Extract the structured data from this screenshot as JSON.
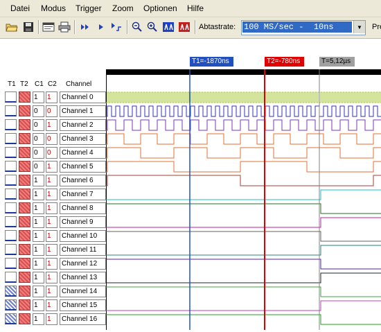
{
  "menu": [
    "Datei",
    "Modus",
    "Trigger",
    "Zoom",
    "Optionen",
    "Hilfe"
  ],
  "toolbar": {
    "buttons": [
      "open-icon",
      "save-icon",
      "window-icon",
      "print-icon",
      "fast-forward-icon",
      "play-icon",
      "trigger-step-icon",
      "zoom-out-icon",
      "zoom-in-icon",
      "marker-t1-icon",
      "marker-t2-icon"
    ],
    "rate_label": "Abtastrate:",
    "rate_value": "100 MS/sec -  10ns",
    "pre_label": "Pre"
  },
  "table_headers": {
    "t1": "T1",
    "t2": "T2",
    "c1": "C1",
    "c2": "C2",
    "channel": "Channel"
  },
  "channels": [
    {
      "name": "Channel 0",
      "c1": "1",
      "c2": "1",
      "t1_hatch": false
    },
    {
      "name": "Channel 1",
      "c1": "0",
      "c2": "0",
      "t1_hatch": false
    },
    {
      "name": "Channel 2",
      "c1": "0",
      "c2": "1",
      "t1_hatch": false
    },
    {
      "name": "Channel 3",
      "c1": "0",
      "c2": "0",
      "t1_hatch": false
    },
    {
      "name": "Channel 4",
      "c1": "0",
      "c2": "0",
      "t1_hatch": false
    },
    {
      "name": "Channel 5",
      "c1": "0",
      "c2": "1",
      "t1_hatch": false
    },
    {
      "name": "Channel 6",
      "c1": "1",
      "c2": "1",
      "t1_hatch": false
    },
    {
      "name": "Channel 7",
      "c1": "1",
      "c2": "1",
      "t1_hatch": false
    },
    {
      "name": "Channel 8",
      "c1": "1",
      "c2": "1",
      "t1_hatch": false
    },
    {
      "name": "Channel 9",
      "c1": "1",
      "c2": "1",
      "t1_hatch": false
    },
    {
      "name": "Channel 10",
      "c1": "1",
      "c2": "1",
      "t1_hatch": false
    },
    {
      "name": "Channel 11",
      "c1": "1",
      "c2": "1",
      "t1_hatch": false
    },
    {
      "name": "Channel 12",
      "c1": "1",
      "c2": "1",
      "t1_hatch": false
    },
    {
      "name": "Channel 13",
      "c1": "1",
      "c2": "1",
      "t1_hatch": false
    },
    {
      "name": "Channel 14",
      "c1": "1",
      "c2": "1",
      "t1_hatch": true
    },
    {
      "name": "Channel 15",
      "c1": "1",
      "c2": "1",
      "t1_hatch": true
    },
    {
      "name": "Channel 16",
      "c1": "1",
      "c2": "1",
      "t1_hatch": true
    }
  ],
  "markers": {
    "t1": {
      "label": "T1=-1870ns",
      "color": "#2050c0"
    },
    "t2": {
      "label": "T2=-780ns",
      "color": "#e00000"
    },
    "t": {
      "label": "T=5,12µs",
      "color": "#a0a0a0"
    }
  },
  "wave_colors": [
    "#a8c838",
    "#3030c0",
    "#8030c0",
    "#e07030",
    "#e07030",
    "#e07030",
    "#a04030",
    "#20c0c0",
    "#207020",
    "#c020a0",
    "#606060",
    "#208080",
    "#5020a0",
    "#202020",
    "#40a040",
    "#c040c0",
    "#20a020"
  ]
}
